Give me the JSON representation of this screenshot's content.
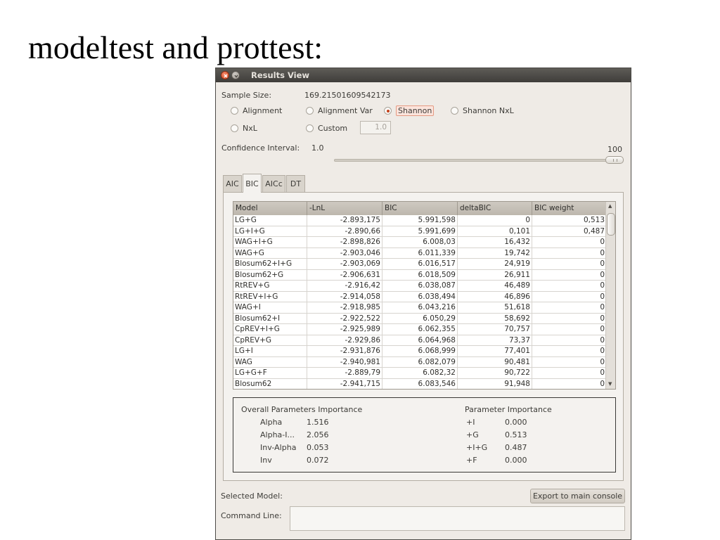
{
  "slide": {
    "title": "modeltest and prottest:"
  },
  "window": {
    "title": "Results View"
  },
  "sample_size": {
    "label": "Sample Size:",
    "value": "169.21501609542173",
    "options": [
      "Alignment",
      "Alignment Var",
      "Shannon",
      "Shannon NxL",
      "NxL",
      "Custom"
    ],
    "selected": "Shannon",
    "custom_value": "1.0"
  },
  "confidence": {
    "label": "Confidence Interval:",
    "value": "1.0",
    "max_label": "100",
    "slider_level_percent": 100
  },
  "tabs": [
    "AIC",
    "BIC",
    "AICc",
    "DT"
  ],
  "active_tab": "BIC",
  "table": {
    "columns": [
      "Model",
      "-LnL",
      "BIC",
      "deltaBIC",
      "BIC weight"
    ],
    "rows": [
      [
        "LG+G",
        "-2.893,175",
        "5.991,598",
        "0",
        "0,513"
      ],
      [
        "LG+I+G",
        "-2.890,66",
        "5.991,699",
        "0,101",
        "0,487"
      ],
      [
        "WAG+I+G",
        "-2.898,826",
        "6.008,03",
        "16,432",
        "0"
      ],
      [
        "WAG+G",
        "-2.903,046",
        "6.011,339",
        "19,742",
        "0"
      ],
      [
        "Blosum62+I+G",
        "-2.903,069",
        "6.016,517",
        "24,919",
        "0"
      ],
      [
        "Blosum62+G",
        "-2.906,631",
        "6.018,509",
        "26,911",
        "0"
      ],
      [
        "RtREV+G",
        "-2.916,42",
        "6.038,087",
        "46,489",
        "0"
      ],
      [
        "RtREV+I+G",
        "-2.914,058",
        "6.038,494",
        "46,896",
        "0"
      ],
      [
        "WAG+I",
        "-2.918,985",
        "6.043,216",
        "51,618",
        "0"
      ],
      [
        "Blosum62+I",
        "-2.922,522",
        "6.050,29",
        "58,692",
        "0"
      ],
      [
        "CpREV+I+G",
        "-2.925,989",
        "6.062,355",
        "70,757",
        "0"
      ],
      [
        "CpREV+G",
        "-2.929,86",
        "6.064,968",
        "73,37",
        "0"
      ],
      [
        "LG+I",
        "-2.931,876",
        "6.068,999",
        "77,401",
        "0"
      ],
      [
        "WAG",
        "-2.940,981",
        "6.082,079",
        "90,481",
        "0"
      ],
      [
        "LG+G+F",
        "-2.889,79",
        "6.082,32",
        "90,722",
        "0"
      ],
      [
        "Blosum62",
        "-2.941,715",
        "6.083,546",
        "91,948",
        "0"
      ]
    ]
  },
  "overall_params": {
    "title": "Overall Parameters Importance",
    "items": [
      {
        "name": "Alpha",
        "value": "1.516"
      },
      {
        "name": "Alpha-I...",
        "value": "2.056"
      },
      {
        "name": "Inv-Alpha",
        "value": "0.053"
      },
      {
        "name": "Inv",
        "value": "0.072"
      }
    ]
  },
  "param_importance": {
    "title": "Parameter Importance",
    "items": [
      {
        "name": "+I",
        "value": "0.000"
      },
      {
        "name": "+G",
        "value": "0.513"
      },
      {
        "name": "+I+G",
        "value": "0.487"
      },
      {
        "name": "+F",
        "value": "0.000"
      }
    ]
  },
  "footer": {
    "selected_model_label": "Selected Model:",
    "export_button": "Export to main console",
    "command_line_label": "Command Line:",
    "command_line_value": ""
  },
  "icons": {
    "close": "close-icon",
    "minimize": "minimize-icon",
    "scroll_up": "arrow-up-icon",
    "scroll_down": "arrow-down-icon"
  },
  "colors": {
    "accent": "#c3421b",
    "titlebar": "#3f3d3a",
    "window_bg": "#efebe6"
  }
}
